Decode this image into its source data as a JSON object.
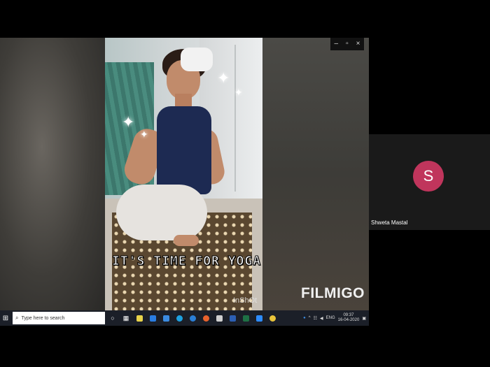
{
  "shared_screen": {
    "window_controls": [
      "–",
      "▫",
      "×"
    ],
    "video": {
      "caption": "IT'S TIME FOR YOGA",
      "watermark_inshot": "InShOt",
      "watermark_filmigo": "FILMIGO"
    },
    "taskbar": {
      "search_placeholder": "Type here to search",
      "tray_lang": "ENG",
      "tray_time": "09:37",
      "tray_date": "16-04-2020"
    }
  },
  "participant": {
    "avatar_initial": "S",
    "avatar_color": "#c0355c",
    "name": "Shweta Mastal"
  }
}
